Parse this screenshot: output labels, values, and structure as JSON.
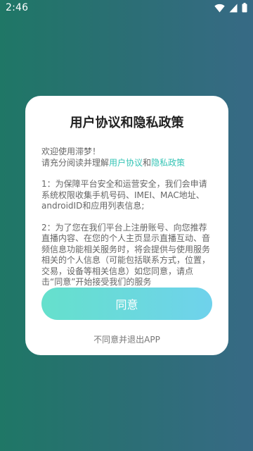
{
  "status_bar": {
    "time": "2:46",
    "icons": [
      "wifi-icon",
      "signal-icon",
      "battery-icon"
    ]
  },
  "dialog": {
    "title": "用户协议和隐私政策",
    "welcome": "欢迎使用滞梦！",
    "intro_prefix": "请充分阅读并理解",
    "user_agreement_link": "用户协议",
    "and_text": "和",
    "privacy_policy_link": "隐私政策",
    "paragraph_1": "1：为保障平台安全和运营安全，我们会申请系统权限收集手机号码、IMEI、MAC地址、androidID和应用列表信息;",
    "paragraph_2": "2：为了您在我们平台上注册账号、向您推荐直播内容、在您的个人主页显示直播互动、音频信息功能相关服务时，将会提供与使用服务相关的个人信息（可能包括联系方式，位置，交易，设备等相关信息）如您同意，请点击“同意”开始接受我们的服务",
    "agree_label": "同意",
    "decline_label": "不同意并退出APP"
  },
  "colors": {
    "link": "#35c4b5",
    "button_gradient_start": "#65e0cc",
    "button_gradient_end": "#6fd2ec",
    "background_start": "#1f7766",
    "background_end": "#376a85"
  }
}
